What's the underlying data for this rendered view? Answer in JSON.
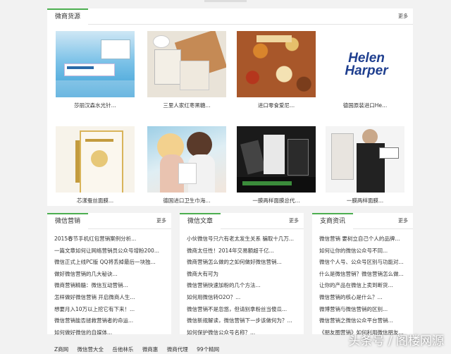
{
  "source_panel": {
    "title": "微商货源",
    "more": "更多",
    "products": [
      {
        "name": "莎丽汉森水光针...",
        "icon": "product-photo"
      },
      {
        "name": "三里人家红枣黑糖...",
        "icon": "product-photo"
      },
      {
        "name": "进口零食爱尼...",
        "icon": "product-photo"
      },
      {
        "name": "德国原装进口He...",
        "icon": "brand-logo",
        "logo_text": "Helen Harper"
      },
      {
        "name": "芯漾蚕丝面膜...",
        "icon": "product-photo"
      },
      {
        "name": "德国进口卫生巾海...",
        "icon": "product-photo"
      },
      {
        "name": "一膜两样面膜总代...",
        "icon": "product-photo"
      },
      {
        "name": "一膜两样面膜...",
        "icon": "product-photo"
      }
    ]
  },
  "wechat_marketing": {
    "title": "微信营销",
    "more": "更多",
    "items": [
      "2015春节手机红包营销案例分析...",
      "一篇文章如何让网络营销员公众号增粉200...",
      "微信正式上线PC版 QQ将丢掉最后一块独...",
      "做好微信营销的几大秘诀...",
      "微商营销精髓：微信互动营销...",
      "怎样做好微信营销 开启微商人生...",
      "想要月入10万以上挖它有下来！...",
      "微信营销能否拯救营销者的命运...",
      "如何做好微信的自媒体..."
    ]
  },
  "wechat_articles": {
    "title": "微信文章",
    "more": "更多",
    "items": [
      "小伙微信号只六有老太发生关系 骗取十几万...",
      "微商太任性！2014年交易额超千亿...",
      "微商营销怎么做的之如何做好微信营销...",
      "微商大有可为",
      "微信营销快速加粉的几个方法...",
      "如何用微信转O2O？...",
      "微信营销不是忽悠，但请别拿粉丝当傻瓜...",
      "微信新规解读，微信营销下一步该做何为？...",
      "如何保护微信公众号名称？..."
    ]
  },
  "commerce_news": {
    "title": "支商资讯",
    "more": "更多",
    "items": [
      "微信营销 要树立自己个人的品牌...",
      "如何让你的微信公众号不同...",
      "微信个人号、公众号区别与功能对...",
      "什么是微信营销？微信营销怎么做...",
      "让你的产品在微信上卖到断货...",
      "微信营销的核心是什么？...",
      "微博营销与微信营销的区别...",
      "微信营销之微信公众平台营销...",
      "《朋友圈营销》如何利用微信朋友..."
    ]
  },
  "footer_links": [
    "Z商网",
    "微信营大全",
    "岳他林乐",
    "微商惠",
    "微商代理",
    "99个精网"
  ],
  "watermark": "头条号 / 阁楼网源",
  "colors": {
    "accent": "#4caf50",
    "background": "#f2f2f2"
  }
}
